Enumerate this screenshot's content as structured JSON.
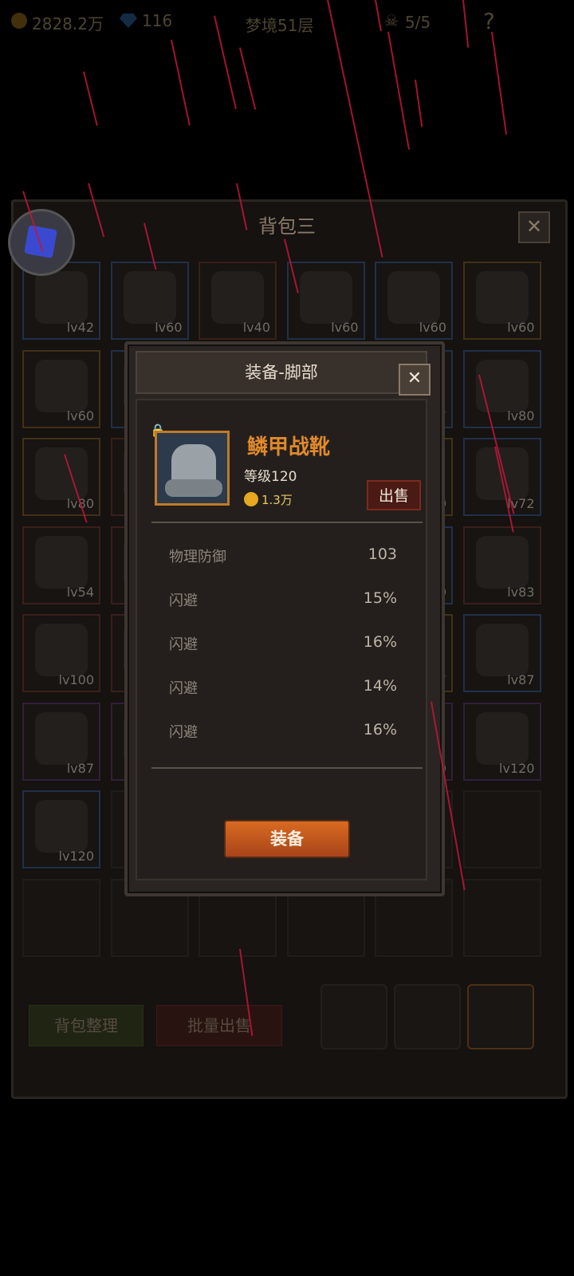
{
  "topbar": {
    "gold": "2828.2万",
    "gems": "116",
    "stage": "梦境51层",
    "skull_count": "5/5",
    "help": "?"
  },
  "bag": {
    "title": "背包三",
    "close": "✕",
    "rows": [
      [
        {
          "lv": "lv42",
          "q": "blue"
        },
        {
          "lv": "lv60",
          "q": "blue"
        },
        {
          "lv": "lv40",
          "q": "red"
        },
        {
          "lv": "lv60",
          "q": "blue"
        },
        {
          "lv": "lv60",
          "q": "blue"
        },
        {
          "lv": "lv60",
          "q": "orange"
        }
      ],
      [
        {
          "lv": "lv60",
          "q": "orange"
        },
        {
          "lv": "",
          "q": "blue"
        },
        {
          "lv": "",
          "q": "blue"
        },
        {
          "lv": "",
          "q": "red"
        },
        {
          "lv": "7",
          "q": "blue"
        },
        {
          "lv": "lv80",
          "q": "blue"
        }
      ],
      [
        {
          "lv": "lv80",
          "q": "orange"
        },
        {
          "lv": "",
          "q": "red"
        },
        {
          "lv": "",
          "q": "red"
        },
        {
          "lv": "",
          "q": "red"
        },
        {
          "lv": "0",
          "q": "orange"
        },
        {
          "lv": "lv72",
          "q": "blue"
        }
      ],
      [
        {
          "lv": "lv54",
          "q": "red"
        },
        {
          "lv": "",
          "q": "red"
        },
        {
          "lv": "",
          "q": "red"
        },
        {
          "lv": "",
          "q": "red"
        },
        {
          "lv": "0",
          "q": "blue"
        },
        {
          "lv": "lv83",
          "q": "red"
        }
      ],
      [
        {
          "lv": "lv100",
          "q": "red"
        },
        {
          "lv": "",
          "q": "red"
        },
        {
          "lv": "",
          "q": "red"
        },
        {
          "lv": "",
          "q": "red"
        },
        {
          "lv": "7",
          "q": "orange"
        },
        {
          "lv": "lv87",
          "q": "blue"
        }
      ],
      [
        {
          "lv": "lv87",
          "q": "purple"
        },
        {
          "lv": "",
          "q": "purple"
        },
        {
          "lv": "",
          "q": "purple"
        },
        {
          "lv": "",
          "q": "purple"
        },
        {
          "lv": "0",
          "q": "purple"
        },
        {
          "lv": "lv120",
          "q": "purple"
        }
      ],
      [
        {
          "lv": "lv120",
          "q": "blue"
        },
        {
          "lv": "",
          "q": "none"
        },
        {
          "lv": "",
          "q": "none"
        },
        {
          "lv": "",
          "q": "none"
        },
        {
          "lv": "",
          "q": "none"
        },
        {
          "lv": "",
          "q": "none"
        }
      ],
      [
        {
          "lv": "",
          "q": "none"
        },
        {
          "lv": "",
          "q": "none"
        },
        {
          "lv": "",
          "q": "none"
        },
        {
          "lv": "",
          "q": "none"
        },
        {
          "lv": "",
          "q": "none"
        },
        {
          "lv": "",
          "q": "none"
        }
      ]
    ],
    "sort_label": "背包整理",
    "bulk_sell_label": "批量出售"
  },
  "modal": {
    "title": "装备-脚部",
    "close": "✕",
    "item_name": "鳞甲战靴",
    "item_level": "等级120",
    "item_price": "1.3万",
    "sell_label": "出售",
    "stats": [
      {
        "name": "物理防御",
        "value": "103"
      },
      {
        "name": "闪避",
        "value": "15%"
      },
      {
        "name": "闪避",
        "value": "16%"
      },
      {
        "name": "闪避",
        "value": "14%"
      },
      {
        "name": "闪避",
        "value": "16%"
      }
    ],
    "equip_label": "装备"
  },
  "colors": {
    "accent_orange": "#e08a2c",
    "rain": "#c0163a",
    "equip_button": "#d86a20"
  }
}
